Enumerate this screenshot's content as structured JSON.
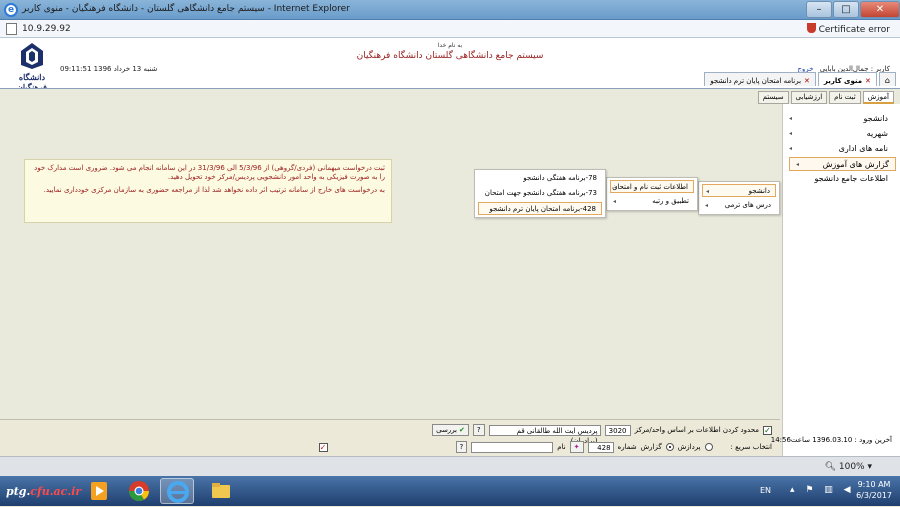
{
  "window": {
    "title": "سیستم جامع دانشگاهی گلستان - دانشگاه فرهنگیان - منوی کاربر - Internet Explorer",
    "minimize": "–",
    "maximize": "□",
    "close": "✕"
  },
  "address": {
    "url": "10.9.29.92",
    "cert_error": "Certificate error"
  },
  "header": {
    "bismillah": "به نام خدا",
    "system_title": "سیستم جامع دانشگاهی گلستان    دانشگاه فرهنگیان",
    "datetime": "09:11:51 شنبه 13 خرداد 1396",
    "user_label": "کاربر : جمال‌الدین بابایی",
    "logout": "خروج",
    "logo_text": "دانشگاه فرهنگیان"
  },
  "tabs": [
    {
      "label": "منوی کاربر",
      "close": "✕"
    },
    {
      "label": "برنامه امتحان پایان ترم دانشجو",
      "close": "✕"
    }
  ],
  "home_tab_icon": "⌂",
  "subtabs": [
    "آموزش",
    "ثبت نام",
    "ارزشیابی",
    "سیستم"
  ],
  "sidebar": {
    "items": [
      {
        "label": "دانشجو"
      },
      {
        "label": "شهریه"
      },
      {
        "label": "نامه های اداری"
      },
      {
        "label": "گزارش های آموزش"
      },
      {
        "label": "اطلاعات جامع دانشجو"
      }
    ]
  },
  "menu1": [
    "دانشجو",
    "درس های ترمی"
  ],
  "menu2": [
    "اطلاعات ثبت نام و امتحان",
    "تطبیق و رتبه"
  ],
  "menu3": [
    "78-برنامه هفتگی دانشجو",
    "73-برنامه هفتگی دانشجو جهت امتحان",
    "428-برنامه امتحان پایان ترم دانشجو"
  ],
  "notice": {
    "p1": "ثبت درخواست میهمانی (فردی/گروهی) از 5/3/96 الی 31/3/96 در این سامانه انجام می شود. ضروری است مدارک خود را به صورت فیزیکی به واحد امور دانشجویی پردیس/مرکز خود تحویل دهید.",
    "p2": "به درخواست های خارج از سامانه ترتیب اثر داده نخواهد شد لذا از مراجعه حضوری به سازمان مرکزی خودداری نمایید."
  },
  "filter": {
    "label": "محدود کردن اطلاعات بر اساس واحد/مرکز",
    "code": "3020",
    "name": "پردیس ایت الله طالقانی قم (برادران)",
    "help": "?",
    "check_btn": "بررسی"
  },
  "quick": {
    "label": "انتخاب سریع :",
    "opt_process": "پردازش",
    "opt_report": "گزارش",
    "number_label": "شماره",
    "number_value": "428",
    "name_label": "نام",
    "help": "?"
  },
  "last_login": "آخرین ورود : 1396.03.10 ساعت14:56",
  "status": {
    "zoom": "100%"
  },
  "taskbar": {
    "start_a": "ptg.",
    "start_b": "cfu.ac.ir",
    "lang": "EN",
    "time": "9:10 AM",
    "date": "6/3/2017"
  }
}
